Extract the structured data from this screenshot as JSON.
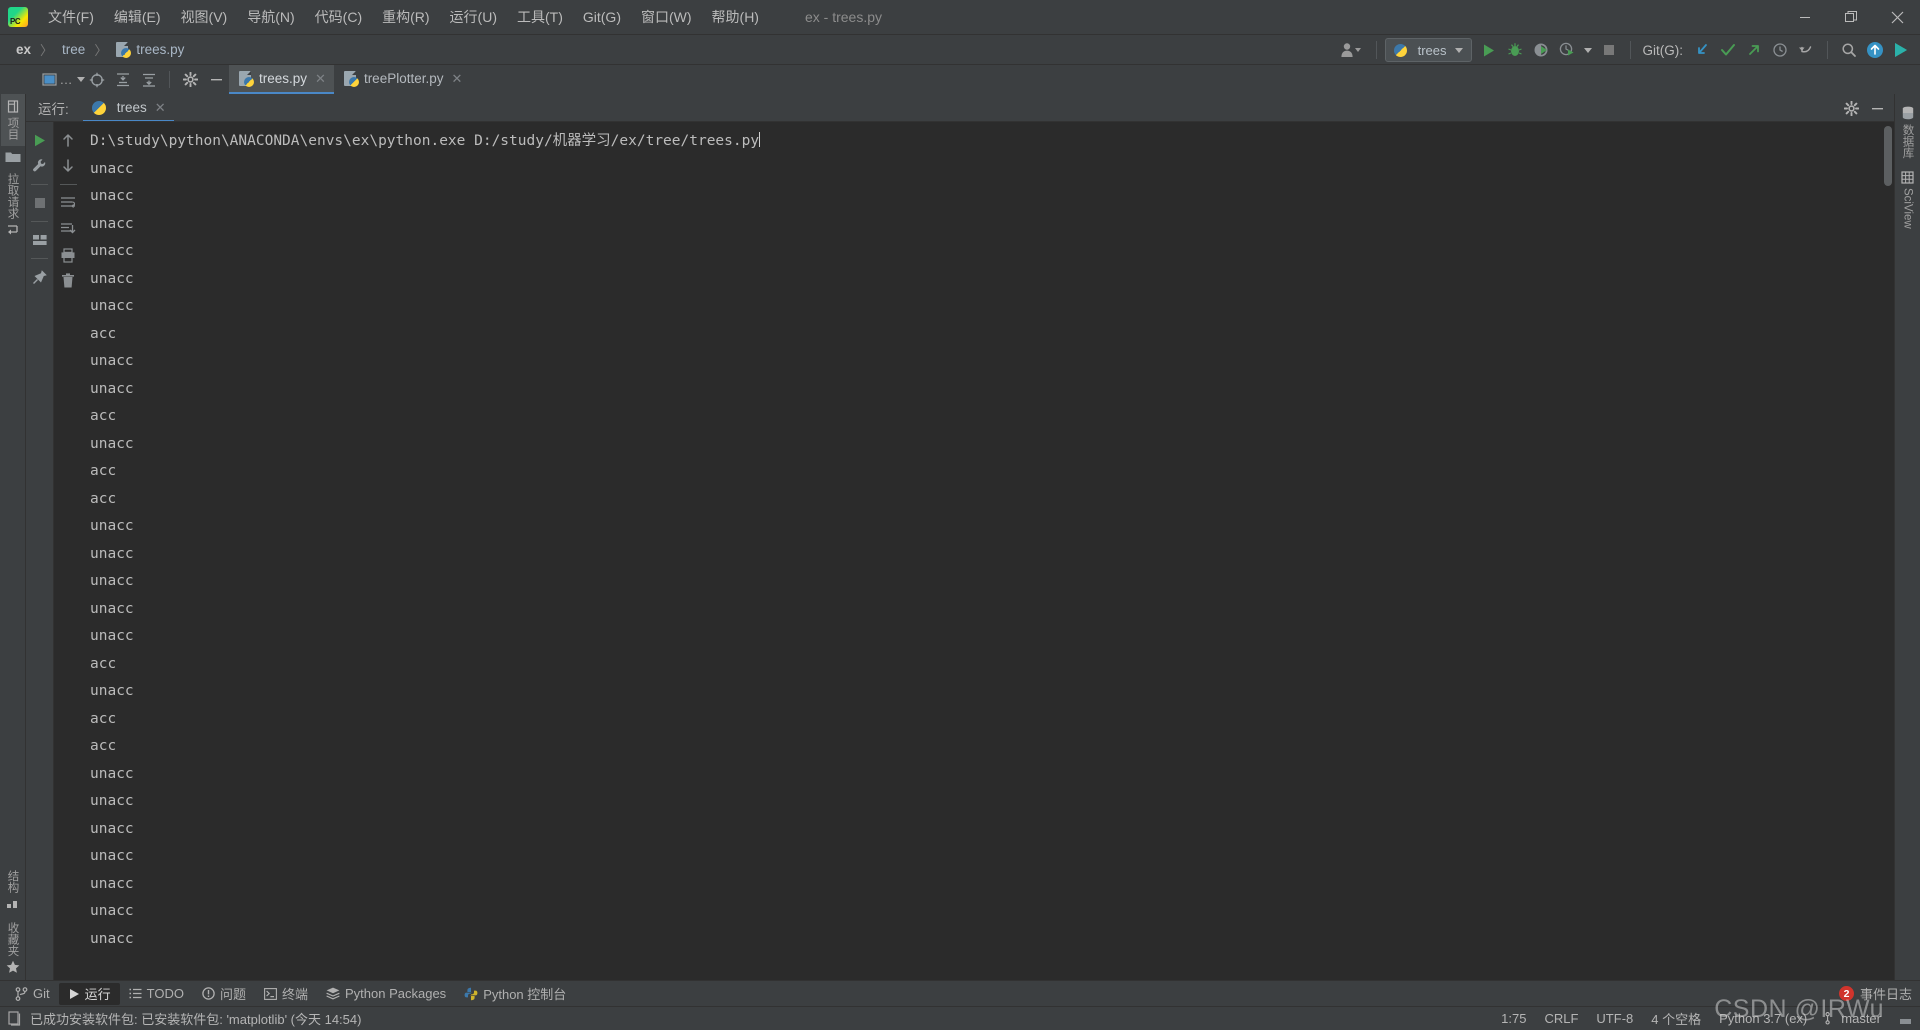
{
  "window": {
    "title": "ex - trees.py",
    "minimize_label": "—",
    "restore_label": "❐",
    "close_label": "✕"
  },
  "menu": {
    "items": [
      {
        "label": "文件(F)",
        "mnemonic": "F"
      },
      {
        "label": "编辑(E)",
        "mnemonic": "E"
      },
      {
        "label": "视图(V)",
        "mnemonic": "V"
      },
      {
        "label": "导航(N)",
        "mnemonic": "N"
      },
      {
        "label": "代码(C)",
        "mnemonic": "C"
      },
      {
        "label": "重构(R)",
        "mnemonic": "R"
      },
      {
        "label": "运行(U)",
        "mnemonic": "U"
      },
      {
        "label": "工具(T)",
        "mnemonic": "T"
      },
      {
        "label": "Git(G)",
        "mnemonic": "G"
      },
      {
        "label": "窗口(W)",
        "mnemonic": "W"
      },
      {
        "label": "帮助(H)",
        "mnemonic": "H"
      }
    ]
  },
  "navbar": {
    "breadcrumbs": [
      "ex",
      "tree",
      "trees.py"
    ],
    "separator": "〉",
    "run_config": "trees",
    "git_label": "Git(G):"
  },
  "editor_tabs": [
    {
      "label": "trees.py",
      "active": true,
      "close": "✕"
    },
    {
      "label": "treePlotter.py",
      "active": false,
      "close": "✕"
    }
  ],
  "run_window": {
    "header_label": "运行:",
    "tab_label": "trees",
    "tab_close": "✕"
  },
  "left_strip": {
    "top": [
      {
        "label": "项目",
        "icon": "project-icon"
      },
      {
        "label": "拉取请求",
        "icon": "pull-request-icon"
      }
    ],
    "bottom": [
      {
        "label": "结构",
        "icon": "structure-icon"
      },
      {
        "label": "收藏夹",
        "icon": "favorites-icon"
      }
    ]
  },
  "right_strip": [
    {
      "label": "数据库",
      "icon": "database-icon"
    },
    {
      "label": "SciView",
      "icon": "sciview-icon"
    }
  ],
  "console": {
    "command": "D:\\study\\python\\ANACONDA\\envs\\ex\\python.exe D:/study/机器学习/ex/tree/trees.py",
    "output": [
      "unacc",
      "unacc",
      "unacc",
      "unacc",
      "unacc",
      "unacc",
      "acc",
      "unacc",
      "unacc",
      "acc",
      "unacc",
      "acc",
      "acc",
      "unacc",
      "unacc",
      "unacc",
      "unacc",
      "unacc",
      "acc",
      "unacc",
      "acc",
      "acc",
      "unacc",
      "unacc",
      "unacc",
      "unacc",
      "unacc",
      "unacc",
      "unacc"
    ]
  },
  "bottom_tools": {
    "items": [
      {
        "label": "Git",
        "icon": "git-branch-icon",
        "selected": false
      },
      {
        "label": "运行",
        "icon": "run-icon",
        "selected": true
      },
      {
        "label": "TODO",
        "icon": "todo-icon",
        "selected": false
      },
      {
        "label": "问题",
        "icon": "problems-icon",
        "selected": false
      },
      {
        "label": "终端",
        "icon": "terminal-icon",
        "selected": false
      },
      {
        "label": "Python Packages",
        "icon": "packages-icon",
        "selected": false
      },
      {
        "label": "Python 控制台",
        "icon": "python-console-icon",
        "selected": false
      }
    ],
    "event_log": "事件日志",
    "event_log_count": "2"
  },
  "status_bar": {
    "message": "已成功安装软件包: 已安装软件包: 'matplotlib' (今天 14:54)",
    "caret_position": "1:75",
    "line_separator": "CRLF",
    "encoding": "UTF-8",
    "indent": "4 个空格",
    "interpreter": "Python 3.7 (ex)",
    "branch": "master"
  },
  "watermark": "CSDN @IRWu",
  "colors": {
    "accent_blue": "#4a88c7",
    "green_run": "#4caf50",
    "console_bg": "#2b2b2b",
    "chrome_bg": "#3c3f41",
    "badge_red": "#d0342c",
    "orange": "#e8762c"
  }
}
